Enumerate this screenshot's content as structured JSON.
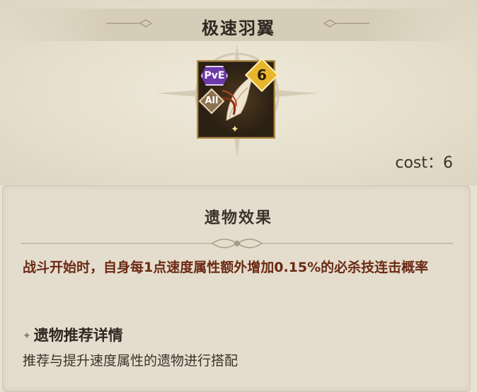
{
  "relic": {
    "name": "极速羽翼",
    "mode_badge": "PvE",
    "rank": "6",
    "scope_badge": "All",
    "cost_text": "cost：6"
  },
  "effect_panel": {
    "title": "遗物效果",
    "description": "战斗开始时，自身每1点速度属性额外增加0.15%的必杀技连击概率"
  },
  "recommendation": {
    "heading": "遗物推荐详情",
    "description": "推荐与提升速度属性的遗物进行搭配"
  },
  "colors": {
    "effect_text": "#6b2a14",
    "pve_badge": "#6b3aa8",
    "rank_badge": "#e9b52c"
  },
  "icons": [
    "compass-star-emblem",
    "wing-relic-icon",
    "sparkle-icon",
    "diamond-bullet-icon"
  ]
}
